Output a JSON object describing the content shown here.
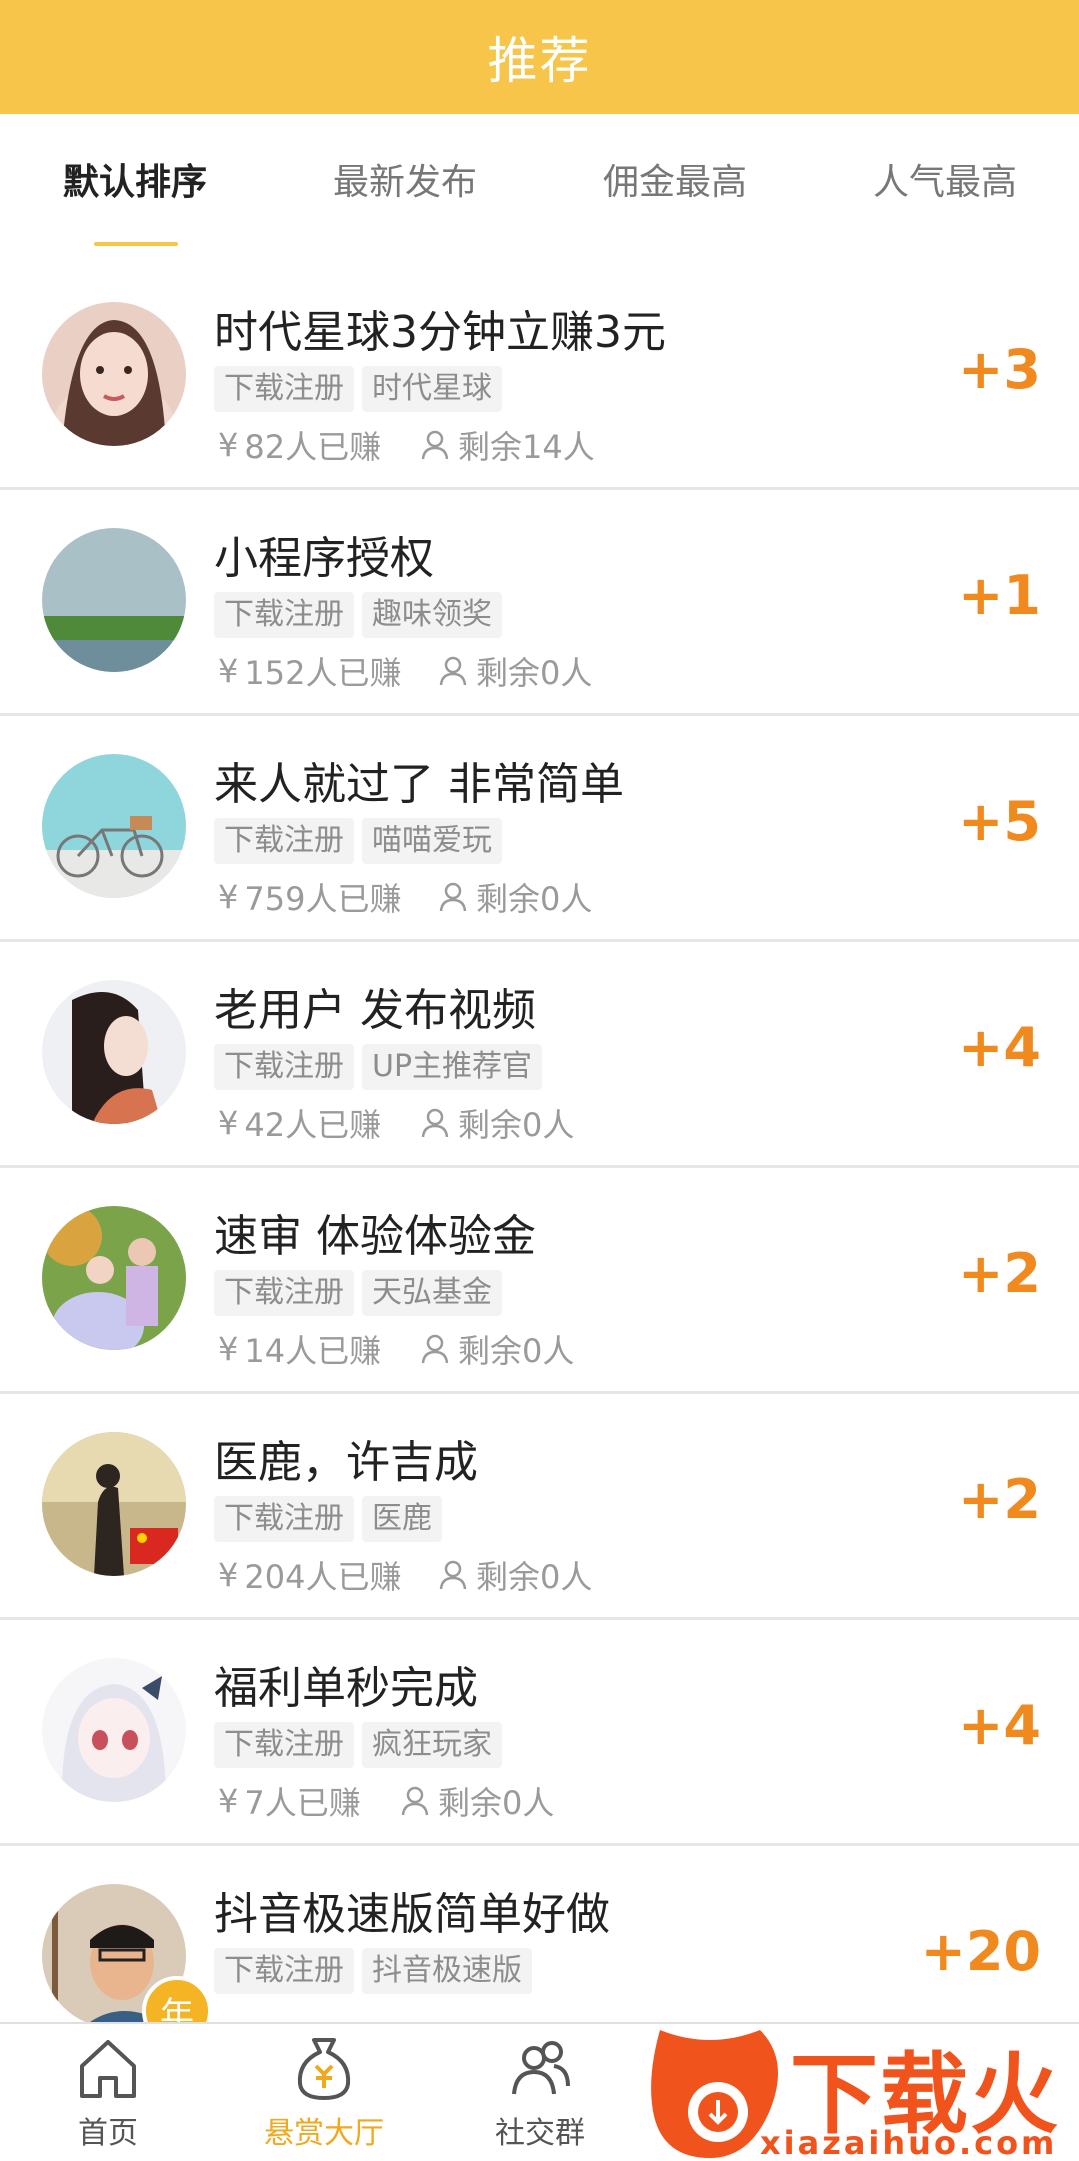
{
  "header": {
    "title": "推荐"
  },
  "sort_tabs": [
    {
      "label": "默认排序",
      "active": true
    },
    {
      "label": "最新发布",
      "active": false
    },
    {
      "label": "佣金最高",
      "active": false
    },
    {
      "label": "人气最高",
      "active": false
    }
  ],
  "tasks": [
    {
      "title": "时代星球3分钟立赚3元",
      "tags": [
        "下载注册",
        "时代星球"
      ],
      "earned": "82人已赚",
      "remaining": "剩余14人",
      "reward": "+3"
    },
    {
      "title": "小程序授权",
      "tags": [
        "下载注册",
        "趣味领奖"
      ],
      "earned": "152人已赚",
      "remaining": "剩余0人",
      "reward": "+1"
    },
    {
      "title": "来人就过了 非常简单",
      "tags": [
        "下载注册",
        "喵喵爱玩"
      ],
      "earned": "759人已赚",
      "remaining": "剩余0人",
      "reward": "+5"
    },
    {
      "title": "老用户 发布视频",
      "tags": [
        "下载注册",
        "UP主推荐官"
      ],
      "earned": "42人已赚",
      "remaining": "剩余0人",
      "reward": "+4"
    },
    {
      "title": "速审 体验体验金",
      "tags": [
        "下载注册",
        "天弘基金"
      ],
      "earned": "14人已赚",
      "remaining": "剩余0人",
      "reward": "+2"
    },
    {
      "title": "医鹿，许吉成",
      "tags": [
        "下载注册",
        "医鹿"
      ],
      "earned": "204人已赚",
      "remaining": "剩余0人",
      "reward": "+2"
    },
    {
      "title": "福利单秒完成",
      "tags": [
        "下载注册",
        "疯狂玩家"
      ],
      "earned": "7人已赚",
      "remaining": "剩余0人",
      "reward": "+4"
    },
    {
      "title": "抖音极速版简单好做",
      "tags": [
        "下载注册",
        "抖音极速版"
      ],
      "earned": "",
      "remaining": "",
      "reward": "+20"
    }
  ],
  "common": {
    "yen": "¥"
  },
  "vip_badge": "年",
  "bottom_nav": [
    {
      "label": "首页",
      "icon": "home-icon",
      "active": false
    },
    {
      "label": "悬赏大厅",
      "icon": "money-bag-icon",
      "active": true
    },
    {
      "label": "社交群",
      "icon": "group-icon",
      "active": false
    }
  ],
  "watermark": {
    "text": "下载火",
    "url": "xiazaihuo.com"
  },
  "colors": {
    "header": "#F6C54A",
    "reward": "#F08A1E",
    "active_nav": "#F0A81E",
    "watermark": "#F0531C"
  }
}
